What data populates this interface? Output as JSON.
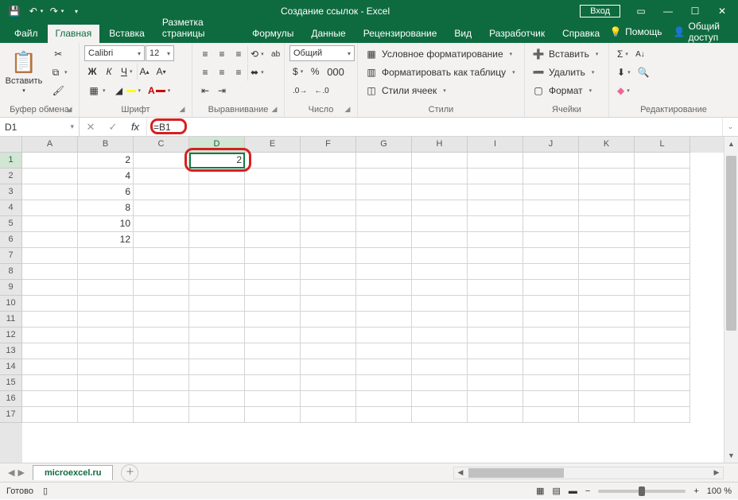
{
  "titlebar": {
    "title": "Создание ссылок  -  Excel",
    "login": "Вход"
  },
  "tabs": {
    "file": "Файл",
    "home": "Главная",
    "insert": "Вставка",
    "layout": "Разметка страницы",
    "formulas": "Формулы",
    "data": "Данные",
    "review": "Рецензирование",
    "view": "Вид",
    "developer": "Разработчик",
    "help": "Справка",
    "tell": "Помощь",
    "share": "Общий доступ"
  },
  "ribbon": {
    "clipboard": {
      "label": "Буфер обмена",
      "paste": "Вставить"
    },
    "font": {
      "label": "Шрифт",
      "name": "Calibri",
      "size": "12",
      "bold": "Ж",
      "italic": "К",
      "underline": "Ч"
    },
    "align": {
      "label": "Выравнивание"
    },
    "number": {
      "label": "Число",
      "format": "Общий"
    },
    "styles": {
      "label": "Стили",
      "cond": "Условное форматирование",
      "table": "Форматировать как таблицу",
      "cell": "Стили ячеек"
    },
    "cells": {
      "label": "Ячейки",
      "insert": "Вставить",
      "delete": "Удалить",
      "format": "Формат"
    },
    "editing": {
      "label": "Редактирование"
    }
  },
  "namebox": "D1",
  "formula": "=B1",
  "columns": [
    "A",
    "B",
    "C",
    "D",
    "E",
    "F",
    "G",
    "H",
    "I",
    "J",
    "K",
    "L"
  ],
  "rows": [
    "1",
    "2",
    "3",
    "4",
    "5",
    "6",
    "7",
    "8",
    "9",
    "10",
    "11",
    "12",
    "13",
    "14",
    "15",
    "16",
    "17"
  ],
  "data_b": [
    "2",
    "4",
    "6",
    "8",
    "10",
    "12"
  ],
  "d1_value": "2",
  "sheet": {
    "name": "microexcel.ru"
  },
  "status": {
    "ready": "Готово",
    "zoom": "100 %"
  }
}
